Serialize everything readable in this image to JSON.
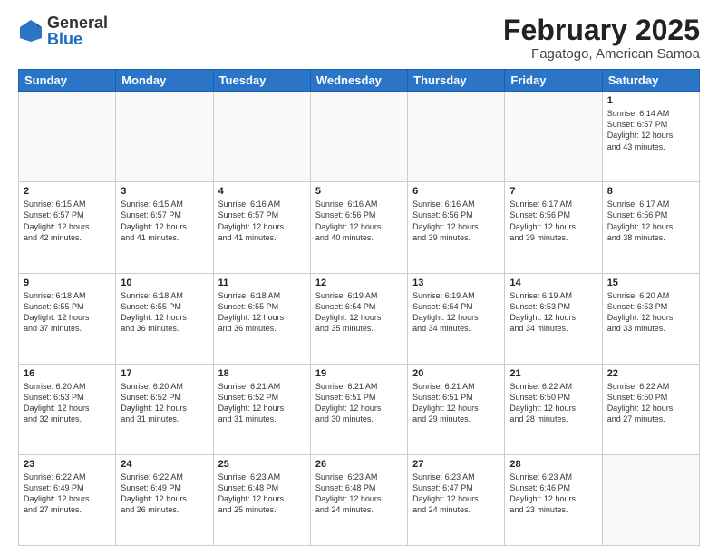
{
  "logo": {
    "general": "General",
    "blue": "Blue"
  },
  "title": {
    "month": "February 2025",
    "location": "Fagatogo, American Samoa"
  },
  "weekdays": [
    "Sunday",
    "Monday",
    "Tuesday",
    "Wednesday",
    "Thursday",
    "Friday",
    "Saturday"
  ],
  "weeks": [
    [
      {
        "day": "",
        "info": ""
      },
      {
        "day": "",
        "info": ""
      },
      {
        "day": "",
        "info": ""
      },
      {
        "day": "",
        "info": ""
      },
      {
        "day": "",
        "info": ""
      },
      {
        "day": "",
        "info": ""
      },
      {
        "day": "1",
        "info": "Sunrise: 6:14 AM\nSunset: 6:57 PM\nDaylight: 12 hours\nand 43 minutes."
      }
    ],
    [
      {
        "day": "2",
        "info": "Sunrise: 6:15 AM\nSunset: 6:57 PM\nDaylight: 12 hours\nand 42 minutes."
      },
      {
        "day": "3",
        "info": "Sunrise: 6:15 AM\nSunset: 6:57 PM\nDaylight: 12 hours\nand 41 minutes."
      },
      {
        "day": "4",
        "info": "Sunrise: 6:16 AM\nSunset: 6:57 PM\nDaylight: 12 hours\nand 41 minutes."
      },
      {
        "day": "5",
        "info": "Sunrise: 6:16 AM\nSunset: 6:56 PM\nDaylight: 12 hours\nand 40 minutes."
      },
      {
        "day": "6",
        "info": "Sunrise: 6:16 AM\nSunset: 6:56 PM\nDaylight: 12 hours\nand 39 minutes."
      },
      {
        "day": "7",
        "info": "Sunrise: 6:17 AM\nSunset: 6:56 PM\nDaylight: 12 hours\nand 39 minutes."
      },
      {
        "day": "8",
        "info": "Sunrise: 6:17 AM\nSunset: 6:56 PM\nDaylight: 12 hours\nand 38 minutes."
      }
    ],
    [
      {
        "day": "9",
        "info": "Sunrise: 6:18 AM\nSunset: 6:55 PM\nDaylight: 12 hours\nand 37 minutes."
      },
      {
        "day": "10",
        "info": "Sunrise: 6:18 AM\nSunset: 6:55 PM\nDaylight: 12 hours\nand 36 minutes."
      },
      {
        "day": "11",
        "info": "Sunrise: 6:18 AM\nSunset: 6:55 PM\nDaylight: 12 hours\nand 36 minutes."
      },
      {
        "day": "12",
        "info": "Sunrise: 6:19 AM\nSunset: 6:54 PM\nDaylight: 12 hours\nand 35 minutes."
      },
      {
        "day": "13",
        "info": "Sunrise: 6:19 AM\nSunset: 6:54 PM\nDaylight: 12 hours\nand 34 minutes."
      },
      {
        "day": "14",
        "info": "Sunrise: 6:19 AM\nSunset: 6:53 PM\nDaylight: 12 hours\nand 34 minutes."
      },
      {
        "day": "15",
        "info": "Sunrise: 6:20 AM\nSunset: 6:53 PM\nDaylight: 12 hours\nand 33 minutes."
      }
    ],
    [
      {
        "day": "16",
        "info": "Sunrise: 6:20 AM\nSunset: 6:53 PM\nDaylight: 12 hours\nand 32 minutes."
      },
      {
        "day": "17",
        "info": "Sunrise: 6:20 AM\nSunset: 6:52 PM\nDaylight: 12 hours\nand 31 minutes."
      },
      {
        "day": "18",
        "info": "Sunrise: 6:21 AM\nSunset: 6:52 PM\nDaylight: 12 hours\nand 31 minutes."
      },
      {
        "day": "19",
        "info": "Sunrise: 6:21 AM\nSunset: 6:51 PM\nDaylight: 12 hours\nand 30 minutes."
      },
      {
        "day": "20",
        "info": "Sunrise: 6:21 AM\nSunset: 6:51 PM\nDaylight: 12 hours\nand 29 minutes."
      },
      {
        "day": "21",
        "info": "Sunrise: 6:22 AM\nSunset: 6:50 PM\nDaylight: 12 hours\nand 28 minutes."
      },
      {
        "day": "22",
        "info": "Sunrise: 6:22 AM\nSunset: 6:50 PM\nDaylight: 12 hours\nand 27 minutes."
      }
    ],
    [
      {
        "day": "23",
        "info": "Sunrise: 6:22 AM\nSunset: 6:49 PM\nDaylight: 12 hours\nand 27 minutes."
      },
      {
        "day": "24",
        "info": "Sunrise: 6:22 AM\nSunset: 6:49 PM\nDaylight: 12 hours\nand 26 minutes."
      },
      {
        "day": "25",
        "info": "Sunrise: 6:23 AM\nSunset: 6:48 PM\nDaylight: 12 hours\nand 25 minutes."
      },
      {
        "day": "26",
        "info": "Sunrise: 6:23 AM\nSunset: 6:48 PM\nDaylight: 12 hours\nand 24 minutes."
      },
      {
        "day": "27",
        "info": "Sunrise: 6:23 AM\nSunset: 6:47 PM\nDaylight: 12 hours\nand 24 minutes."
      },
      {
        "day": "28",
        "info": "Sunrise: 6:23 AM\nSunset: 6:46 PM\nDaylight: 12 hours\nand 23 minutes."
      },
      {
        "day": "",
        "info": ""
      }
    ]
  ]
}
